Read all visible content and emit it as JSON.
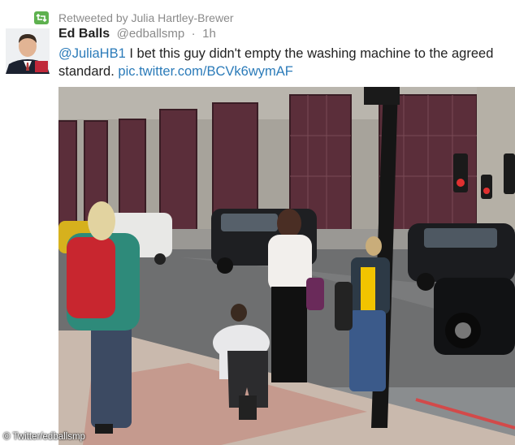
{
  "retweet": {
    "icon": "retweet-icon",
    "text": "Retweeted by Julia Hartley-Brewer"
  },
  "tweet": {
    "author_name": "Ed Balls",
    "author_handle": "@edballsmp",
    "time": "1h",
    "mention": "@JuliaHB1",
    "text_before_link": " I bet this guy didn't empty the washing machine to the agreed standard. ",
    "link": "pic.twitter.com/BCVk6wymAF"
  },
  "photo": {
    "description_icon": "street-scene-photo"
  },
  "credit": "© Twitter/edballsmp",
  "colors": {
    "link": "#2b7bb9",
    "retweet_green": "#5eb14f",
    "muted": "#8a8a8a"
  }
}
